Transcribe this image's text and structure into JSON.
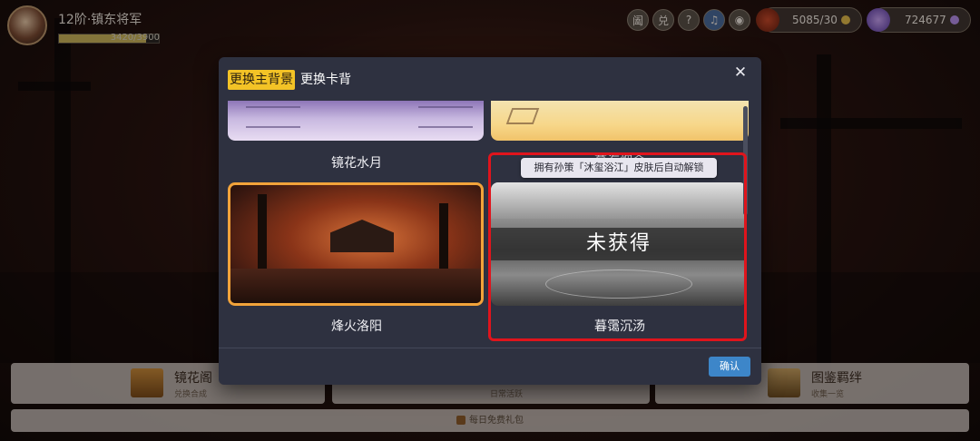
{
  "player": {
    "rank_title": "12阶·镇东将军",
    "exp_text": "3420/3900",
    "exp_progress": 0.877
  },
  "topbar": {
    "buttons": [
      {
        "label": "阖",
        "icon": "circle-glyph-icon"
      },
      {
        "label": "兑",
        "icon": "circle-glyph-icon"
      },
      {
        "label": "?",
        "icon": "help-icon"
      },
      {
        "label": "♫",
        "icon": "music-icon"
      },
      {
        "label": "◉",
        "icon": "eye-icon"
      }
    ],
    "resource1": {
      "value": "5085/30",
      "icon": "pouch-icon"
    },
    "resource2": {
      "value": "724677",
      "icon": "gem-icon"
    }
  },
  "modal": {
    "tabs": [
      {
        "label": "更换主背景",
        "active": true
      },
      {
        "label": "更换卡背",
        "active": false
      }
    ],
    "close_label": "✕",
    "items": [
      {
        "name": "镜花水月",
        "state": "normal"
      },
      {
        "name": "暮海烟金",
        "state": "normal"
      },
      {
        "name": "烽火洛阳",
        "state": "selected"
      },
      {
        "name": "暮霭沉汤",
        "state": "locked"
      }
    ],
    "locked_label": "未获得",
    "unlock_tooltip": "拥有孙策「沐玺浴江」皮肤后自动解锁",
    "confirm_label": "确认"
  },
  "bottom_menu": {
    "left": {
      "title": "镜花阁",
      "subtitle": "兑换合成"
    },
    "middle": {
      "subtitle": "日常活跃"
    },
    "right": {
      "title": "图鉴羁绊",
      "subtitle": "收集一览"
    },
    "strip_label": "每日免费礼包"
  },
  "colors": {
    "accent_tab": "#f3c326",
    "confirm": "#3d86c9",
    "highlight_border": "#e0141c",
    "selected_border": "#f2a33a"
  }
}
